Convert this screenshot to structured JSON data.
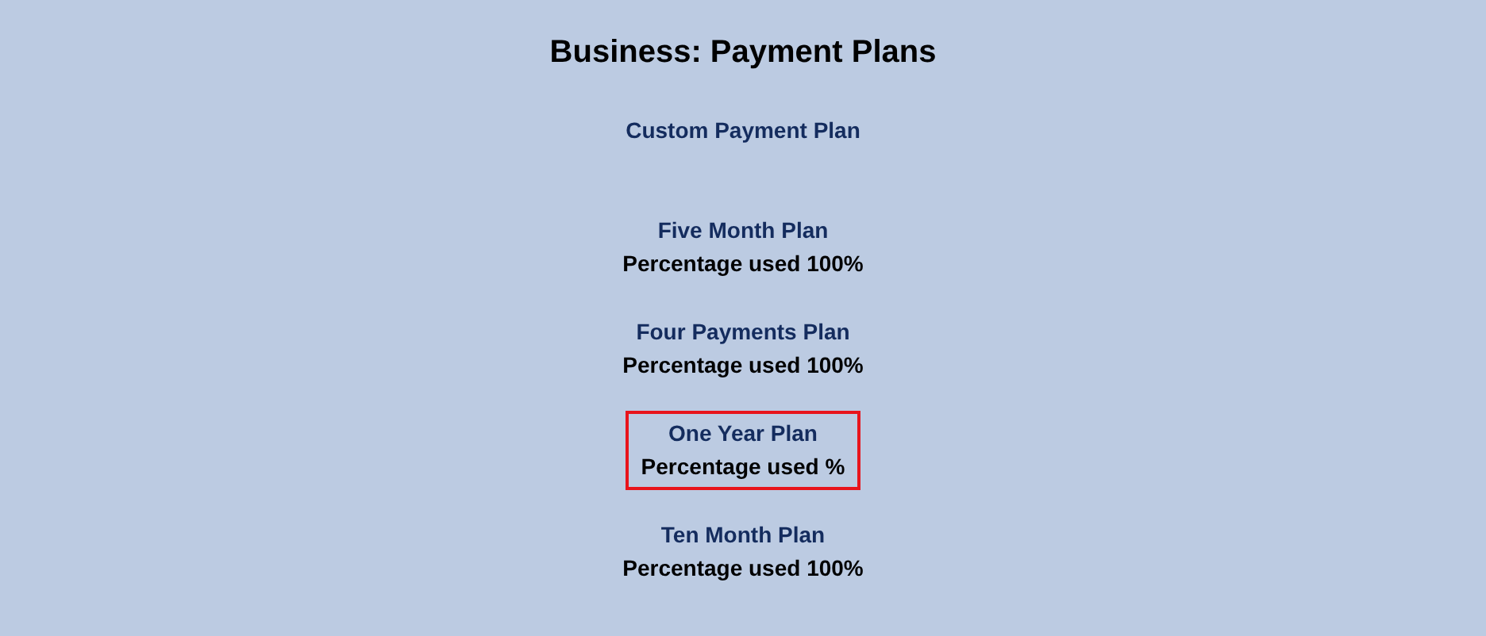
{
  "title": "Business: Payment Plans",
  "custom_plan_link": "Custom Payment Plan",
  "plans": [
    {
      "name": "Five Month Plan",
      "usage": "Percentage used 100%",
      "highlighted": false
    },
    {
      "name": "Four Payments Plan",
      "usage": "Percentage used 100%",
      "highlighted": false
    },
    {
      "name": "One Year Plan",
      "usage": "Percentage used %",
      "highlighted": true
    },
    {
      "name": "Ten Month Plan",
      "usage": "Percentage used 100%",
      "highlighted": false
    }
  ]
}
